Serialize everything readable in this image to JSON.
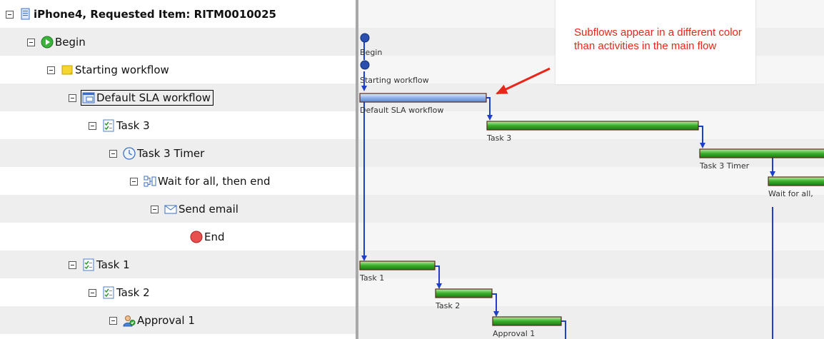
{
  "colors": {
    "row_alt": "#eeeeee",
    "activity_bar": "#3aae2a",
    "subflow_bar": "#8fb2e8",
    "connector": "#1e3fc8",
    "annotation": "#e8261a"
  },
  "tree": {
    "rows": [
      {
        "label": "iPhone4, Requested Item: RITM0010025",
        "icon": "requested-item-icon"
      },
      {
        "label": "Begin",
        "icon": "begin-icon"
      },
      {
        "label": "Starting workflow",
        "icon": "note-icon"
      },
      {
        "label": "Default SLA workflow",
        "icon": "subflow-icon"
      },
      {
        "label": "Task 3",
        "icon": "task-icon"
      },
      {
        "label": "Task 3 Timer",
        "icon": "timer-icon"
      },
      {
        "label": "Wait for all, then end",
        "icon": "join-icon"
      },
      {
        "label": "Send email",
        "icon": "email-icon"
      },
      {
        "label": "End",
        "icon": "end-icon"
      },
      {
        "label": "Task 1",
        "icon": "task-icon"
      },
      {
        "label": "Task 2",
        "icon": "task-icon"
      },
      {
        "label": "Approval 1",
        "icon": "approval-icon"
      }
    ]
  },
  "gantt": {
    "labels": {
      "begin": "Begin",
      "starting": "Starting workflow",
      "sla": "Default SLA workflow",
      "task3": "Task 3",
      "timer": "Task 3 Timer",
      "wait": "Wait for all,",
      "task1": "Task 1",
      "task2": "Task 2",
      "approval": "Approval 1"
    }
  },
  "annotation": {
    "text": "Subflows appear in a different color than activities in the main flow"
  }
}
